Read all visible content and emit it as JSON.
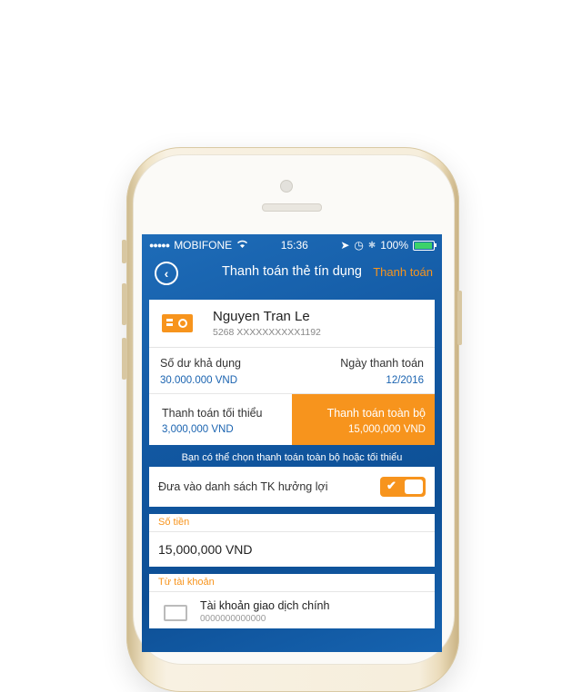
{
  "status_bar": {
    "carrier": "MOBIFONE",
    "time": "15:36",
    "battery": "100%"
  },
  "nav": {
    "title": "Thanh toán thẻ tín dụng",
    "action": "Thanh toán"
  },
  "card": {
    "holder": "Nguyen Tran Le",
    "number": "5268 XXXXXXXXXX1192"
  },
  "balance": {
    "label": "Số dư khả dụng",
    "value": "30.000.000 VND"
  },
  "payment_date": {
    "label": "Ngày thanh toán",
    "value": "12/2016"
  },
  "payment_options": [
    {
      "label": "Thanh toán tối thiểu",
      "amount": "3,000,000 VND",
      "selected": false
    },
    {
      "label": "Thanh toán toàn bộ",
      "amount": "15,000,000 VND",
      "selected": true
    }
  ],
  "hint": "Bạn có thể chọn thanh toán toàn bộ hoặc tối thiểu",
  "beneficiary_toggle": {
    "label": "Đưa vào danh sách TK hưởng lợi",
    "on": true
  },
  "amount_field": {
    "label": "Số tiền",
    "value": "15,000,000 VND"
  },
  "from_account": {
    "label": "Từ tài khoản",
    "name": "Tài khoản giao dịch chính",
    "number": "0000000000000"
  },
  "colors": {
    "accent": "#f7941d",
    "primary_blue": "#1258a2",
    "value_blue": "#1a63b0"
  }
}
